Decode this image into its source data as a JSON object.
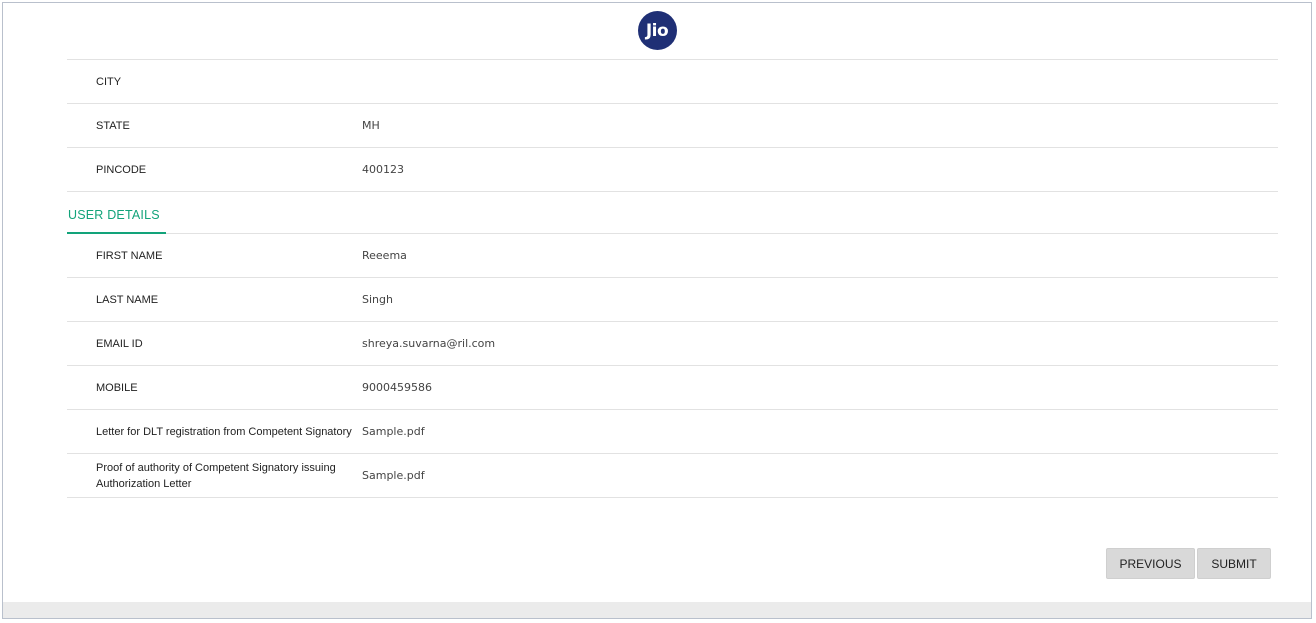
{
  "logo": {
    "text": "Jio",
    "color": "#1f2f75"
  },
  "address_rows": [
    {
      "label": "CITY",
      "value": ""
    },
    {
      "label": "STATE",
      "value": "MH"
    },
    {
      "label": "PINCODE",
      "value": "400123"
    }
  ],
  "user_section": {
    "title": "USER DETAILS",
    "accent": "#12a37a"
  },
  "user_rows": [
    {
      "label": "FIRST NAME",
      "value": "Reeema"
    },
    {
      "label": "LAST NAME",
      "value": "Singh"
    },
    {
      "label": "EMAIL ID",
      "value": "shreya.suvarna@ril.com"
    },
    {
      "label": "MOBILE",
      "value": "9000459586"
    },
    {
      "label": "Letter for DLT registration from Competent Signatory",
      "value": "Sample.pdf"
    },
    {
      "label": "Proof of authority of Competent Signatory issuing Authorization Letter",
      "value": "Sample.pdf"
    }
  ],
  "actions": {
    "previous": "PREVIOUS",
    "submit": "SUBMIT"
  }
}
